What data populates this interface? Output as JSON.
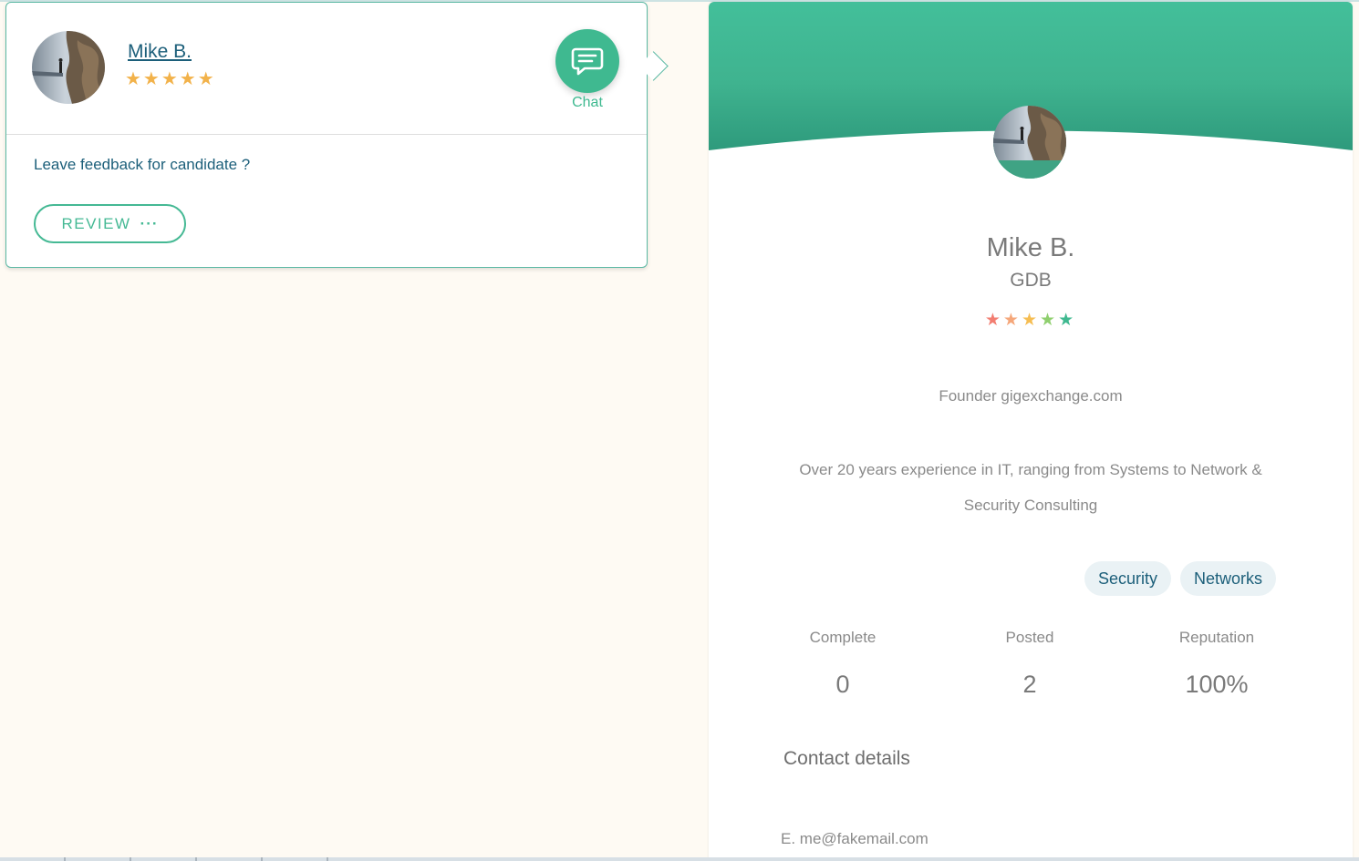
{
  "candidate_card": {
    "name": "Mike B.",
    "rating_stars": "★★★★★",
    "chat_label": "Chat",
    "feedback_prompt": "Leave feedback for candidate ?",
    "review_label": "REVIEW",
    "review_more": "···"
  },
  "profile": {
    "name": "Mike B.",
    "company": "GDB",
    "rating": 5,
    "star_colors": [
      "#f27d71",
      "#f5a77a",
      "#f6bd52",
      "#8fcf6e",
      "#3fb990"
    ],
    "title": "Founder gigexchange.com",
    "bio": "Over 20 years experience in IT, ranging from Systems to Network & Security Consulting",
    "tags": [
      "Security",
      "Networks"
    ],
    "stats": [
      {
        "label": "Complete",
        "value": "0"
      },
      {
        "label": "Posted",
        "value": "2"
      },
      {
        "label": "Reputation",
        "value": "100%"
      }
    ],
    "contact_heading": "Contact details",
    "email": "E. me@fakemail.com"
  },
  "colors": {
    "accent": "#3fb990",
    "header_top": "#43bf9a",
    "header_bottom": "#2e9a7c",
    "link": "#1c5f7a",
    "star": "#f2b24a",
    "background": "#fefaf3"
  },
  "icons": {
    "chat": "chat-bubble-icon",
    "star": "star-icon"
  }
}
